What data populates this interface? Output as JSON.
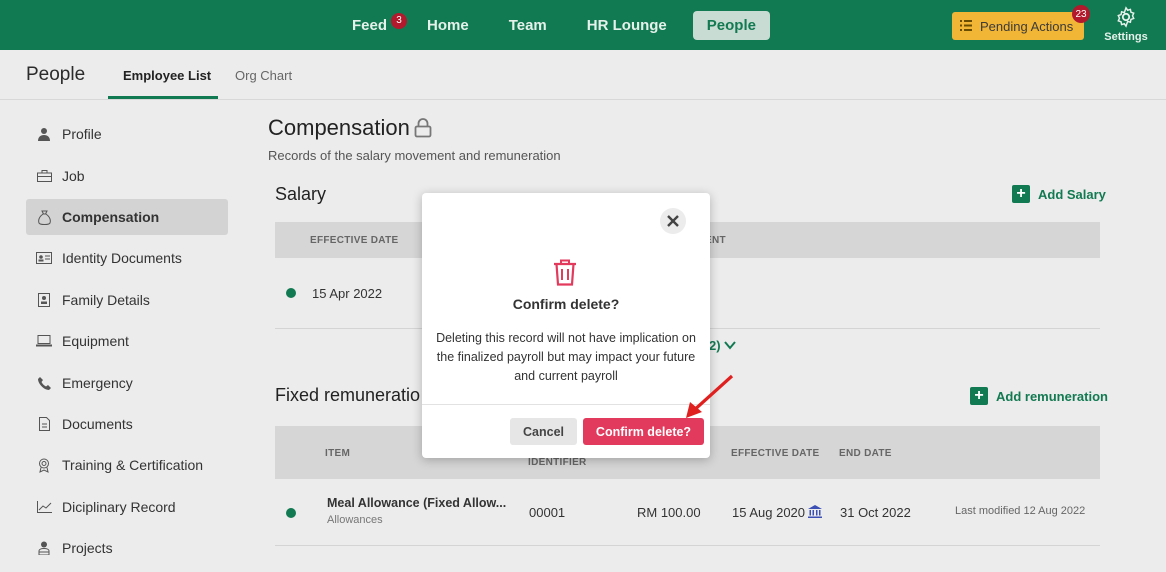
{
  "topnav": {
    "items": [
      {
        "label": "Feed",
        "badge": "3"
      },
      {
        "label": "Home"
      },
      {
        "label": "Team"
      },
      {
        "label": "HR Lounge"
      },
      {
        "label": "People",
        "active": true
      }
    ],
    "pending_label": "Pending Actions",
    "pending_badge": "23",
    "settings_label": "Settings"
  },
  "subheader": {
    "title": "People",
    "tabs": [
      "Employee List",
      "Org Chart"
    ]
  },
  "sidebar": {
    "items": [
      {
        "label": "Profile",
        "icon": "person-icon"
      },
      {
        "label": "Job",
        "icon": "briefcase-icon"
      },
      {
        "label": "Compensation",
        "icon": "money-bag-icon",
        "active": true
      },
      {
        "label": "Identity Documents",
        "icon": "id-card-icon"
      },
      {
        "label": "Family Details",
        "icon": "family-icon"
      },
      {
        "label": "Equipment",
        "icon": "laptop-icon"
      },
      {
        "label": "Emergency",
        "icon": "phone-icon"
      },
      {
        "label": "Documents",
        "icon": "document-icon"
      },
      {
        "label": "Training & Certification",
        "icon": "award-icon"
      },
      {
        "label": "Diciplinary Record",
        "icon": "chart-icon"
      },
      {
        "label": "Projects",
        "icon": "projects-icon"
      }
    ]
  },
  "content": {
    "title": "Compensation",
    "subtitle": "Records of the salary movement and remuneration",
    "salary": {
      "title": "Salary",
      "add_label": "Add Salary",
      "headers": [
        "EFFECTIVE DATE",
        "ENT"
      ],
      "row_date": "15 Apr 2022",
      "more_label": "2)"
    },
    "remuneration": {
      "title": "Fixed remuneratio",
      "add_label": "Add remuneration",
      "headers": [
        "ITEM",
        "IDENTIFIER",
        "EFFECTIVE DATE",
        "END DATE"
      ],
      "row": {
        "item": "Meal Allowance (Fixed Allow...",
        "category": "Allowances",
        "identifier": "00001",
        "amount": "RM 100.00",
        "effective": "15 Aug 2020",
        "end": "31 Oct 2022",
        "modified": "Last modified 12 Aug 2022"
      }
    }
  },
  "modal": {
    "title": "Confirm delete?",
    "body": "Deleting this record will not have implication on the finalized payroll but may impact your future and current payroll",
    "cancel_label": "Cancel",
    "confirm_label": "Confirm delete?"
  },
  "colors": {
    "brand": "#127a52",
    "danger": "#e23a5c",
    "pending": "#f2b636",
    "badge": "#b3192c"
  }
}
